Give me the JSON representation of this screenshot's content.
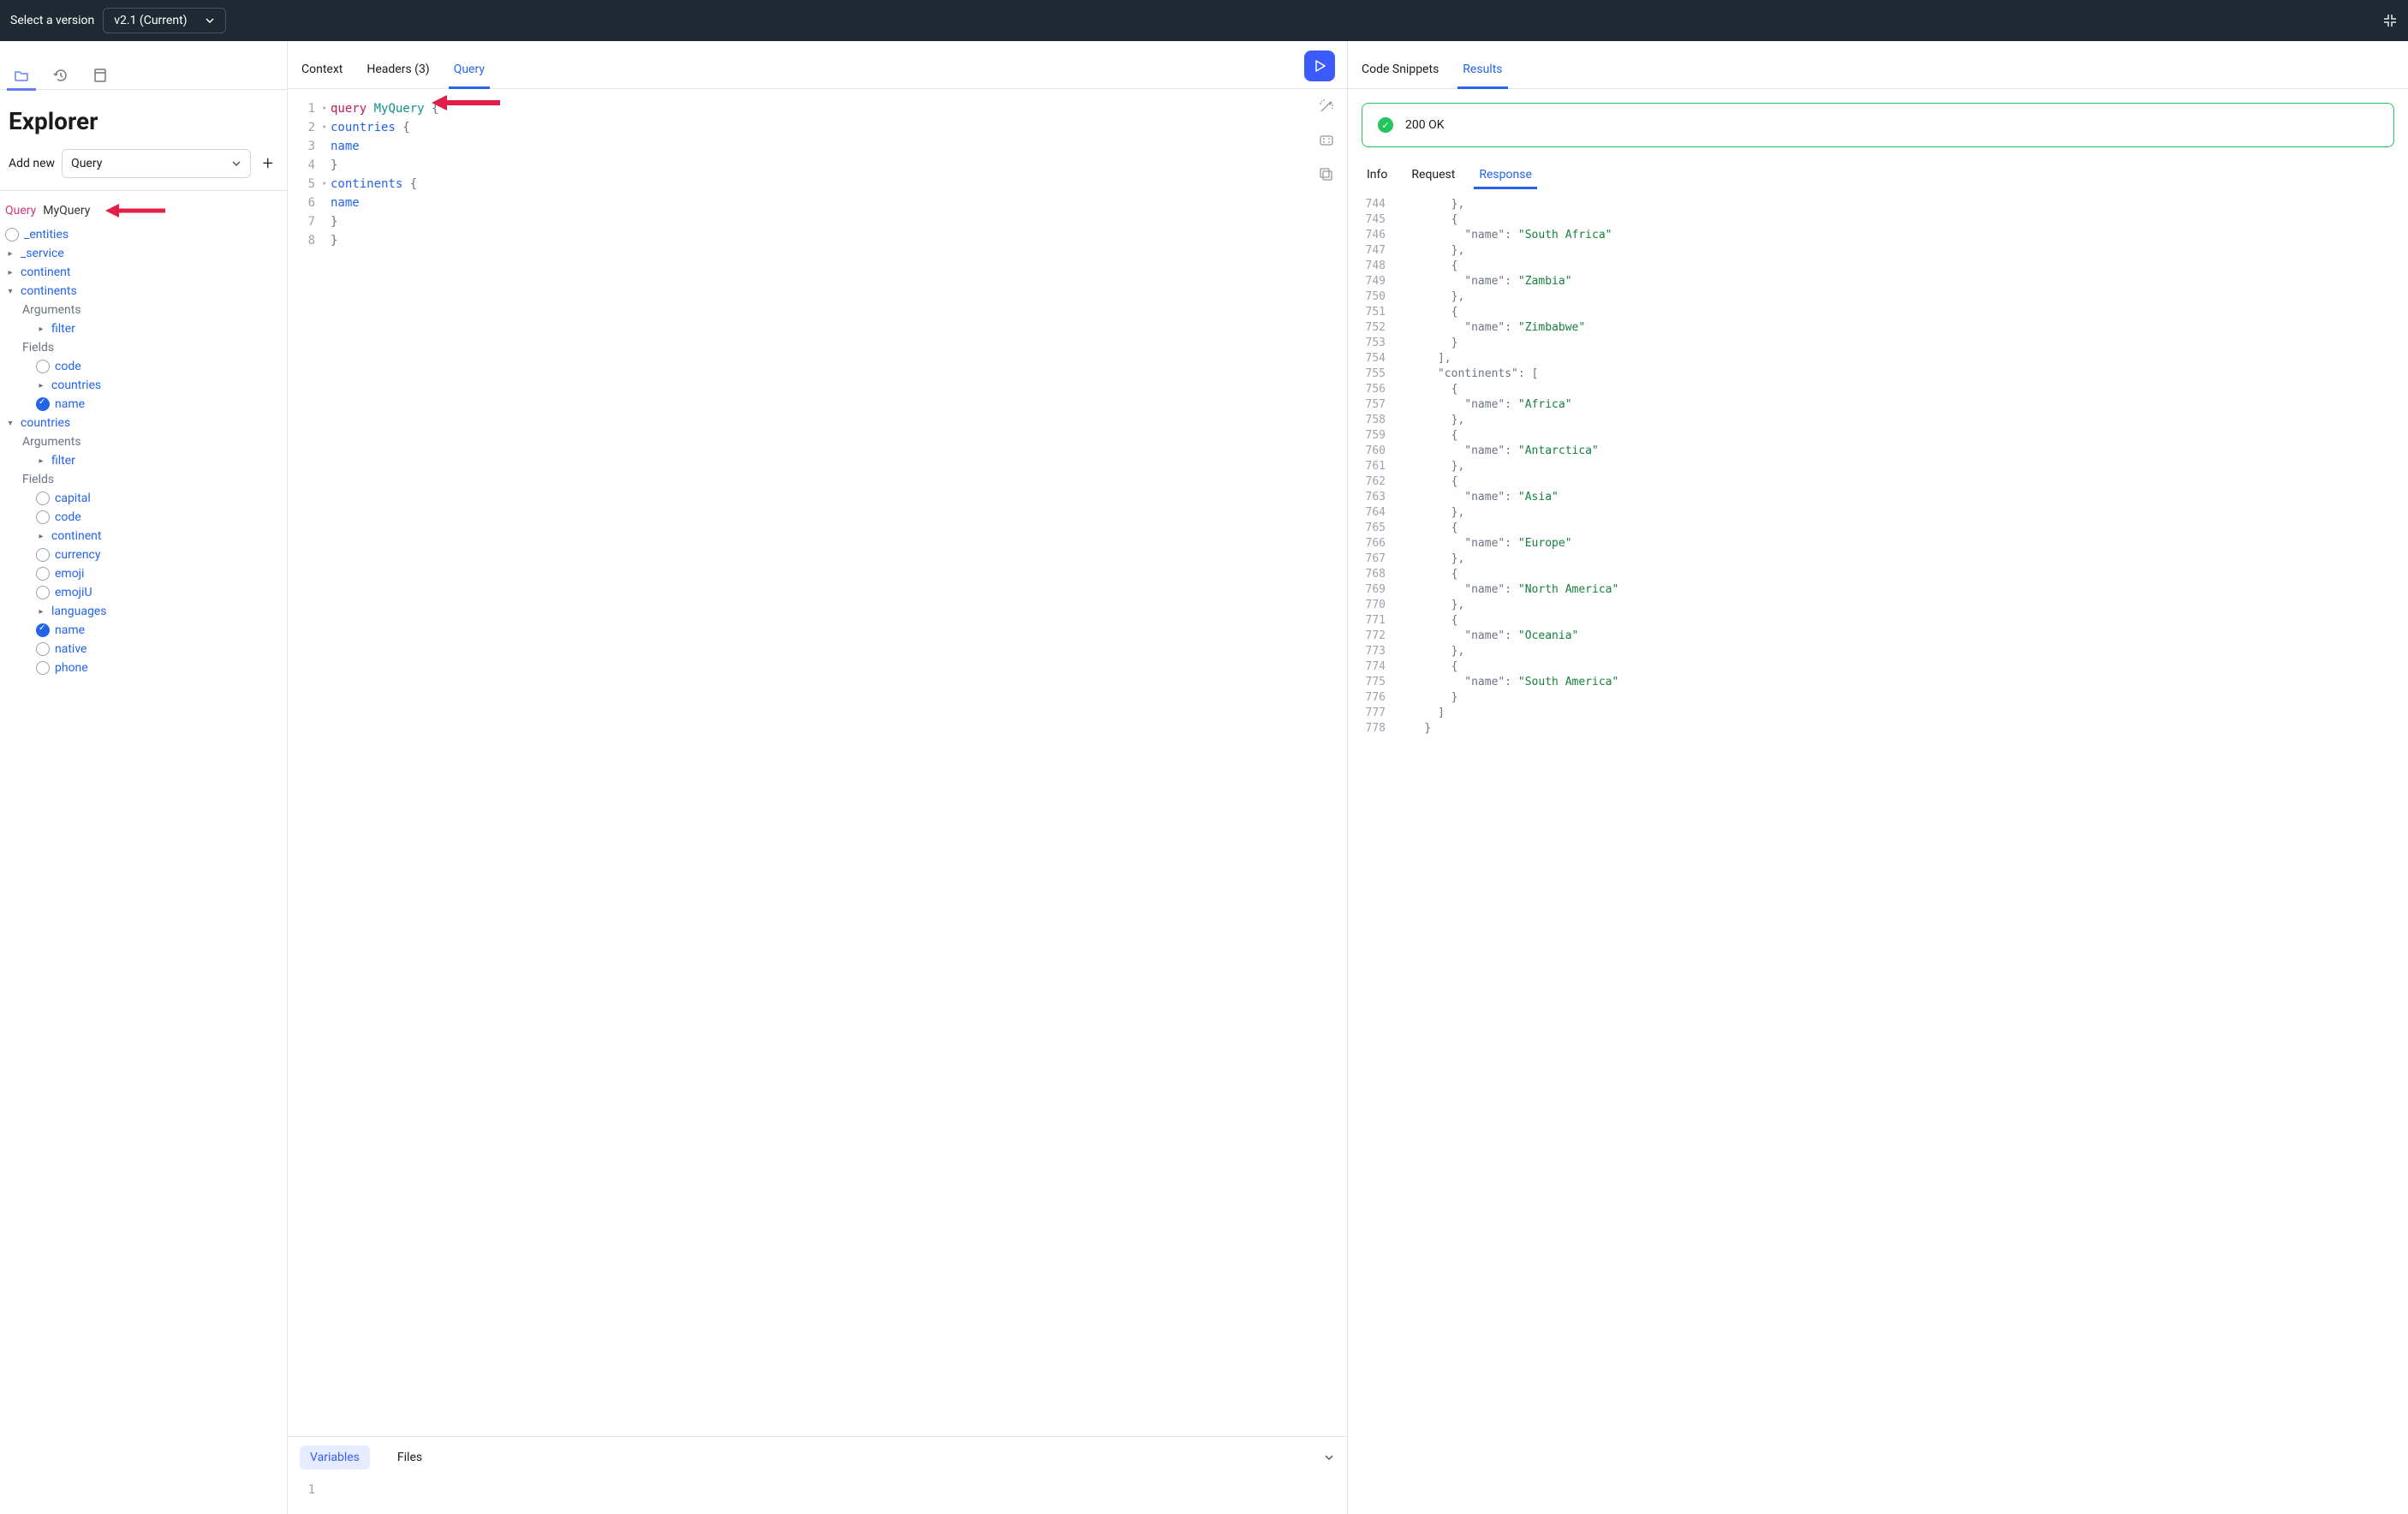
{
  "topbar": {
    "version_label": "Select a version",
    "version_value": "v2.1 (Current)"
  },
  "sidebar": {
    "title": "Explorer",
    "add_new_label": "Add new",
    "query_type": "Query",
    "query_keyword": "Query",
    "query_name": "MyQuery",
    "tree": {
      "entities": "_entities",
      "service": "_service",
      "continent": "continent",
      "continents": "continents",
      "countries": "countries",
      "arguments": "Arguments",
      "fields": "Fields",
      "filter": "filter",
      "code": "code",
      "countries_field": "countries",
      "name": "name",
      "capital": "capital",
      "continent_field": "continent",
      "currency": "currency",
      "emoji": "emoji",
      "emojiU": "emojiU",
      "languages": "languages",
      "native": "native",
      "phone": "phone"
    }
  },
  "middle": {
    "tabs": {
      "context": "Context",
      "headers": "Headers (3)",
      "query": "Query"
    },
    "bottom_tabs": {
      "variables": "Variables",
      "files": "Files"
    },
    "code": [
      {
        "n": "1",
        "fold": "▾",
        "html": "<span class='tok-keyword'>query</span> <span class='tok-name'>MyQuery</span> <span class='tok-brace'>{</span>"
      },
      {
        "n": "2",
        "fold": "▾",
        "html": "  <span class='tok-field'>countries</span> <span class='tok-brace'>{</span>"
      },
      {
        "n": "3",
        "fold": "",
        "html": "    <span class='tok-field'>name</span>"
      },
      {
        "n": "4",
        "fold": "",
        "html": "  <span class='tok-brace'>}</span>"
      },
      {
        "n": "5",
        "fold": "▾",
        "html": "  <span class='tok-field'>continents</span> <span class='tok-brace'>{</span>"
      },
      {
        "n": "6",
        "fold": "",
        "html": "    <span class='tok-field'>name</span>"
      },
      {
        "n": "7",
        "fold": "",
        "html": "  <span class='tok-brace'>}</span>"
      },
      {
        "n": "8",
        "fold": "",
        "html": "<span class='tok-brace'>}</span>"
      }
    ]
  },
  "right": {
    "tabs": {
      "snippets": "Code Snippets",
      "results": "Results"
    },
    "status": "200 OK",
    "sub_tabs": {
      "info": "Info",
      "request": "Request",
      "response": "Response"
    },
    "response": [
      {
        "n": "744",
        "html": "        <span class='j-punc'>},</span>"
      },
      {
        "n": "745",
        "html": "        <span class='j-punc'>{</span>"
      },
      {
        "n": "746",
        "html": "          <span class='j-key'>\"name\"</span><span class='j-punc'>: </span><span class='j-str'>\"South Africa\"</span>"
      },
      {
        "n": "747",
        "html": "        <span class='j-punc'>},</span>"
      },
      {
        "n": "748",
        "html": "        <span class='j-punc'>{</span>"
      },
      {
        "n": "749",
        "html": "          <span class='j-key'>\"name\"</span><span class='j-punc'>: </span><span class='j-str'>\"Zambia\"</span>"
      },
      {
        "n": "750",
        "html": "        <span class='j-punc'>},</span>"
      },
      {
        "n": "751",
        "html": "        <span class='j-punc'>{</span>"
      },
      {
        "n": "752",
        "html": "          <span class='j-key'>\"name\"</span><span class='j-punc'>: </span><span class='j-str'>\"Zimbabwe\"</span>"
      },
      {
        "n": "753",
        "html": "        <span class='j-punc'>}</span>"
      },
      {
        "n": "754",
        "html": "      <span class='j-punc'>],</span>"
      },
      {
        "n": "755",
        "html": "      <span class='j-key'>\"continents\"</span><span class='j-punc'>: [</span>"
      },
      {
        "n": "756",
        "html": "        <span class='j-punc'>{</span>"
      },
      {
        "n": "757",
        "html": "          <span class='j-key'>\"name\"</span><span class='j-punc'>: </span><span class='j-str'>\"Africa\"</span>"
      },
      {
        "n": "758",
        "html": "        <span class='j-punc'>},</span>"
      },
      {
        "n": "759",
        "html": "        <span class='j-punc'>{</span>"
      },
      {
        "n": "760",
        "html": "          <span class='j-key'>\"name\"</span><span class='j-punc'>: </span><span class='j-str'>\"Antarctica\"</span>"
      },
      {
        "n": "761",
        "html": "        <span class='j-punc'>},</span>"
      },
      {
        "n": "762",
        "html": "        <span class='j-punc'>{</span>"
      },
      {
        "n": "763",
        "html": "          <span class='j-key'>\"name\"</span><span class='j-punc'>: </span><span class='j-str'>\"Asia\"</span>"
      },
      {
        "n": "764",
        "html": "        <span class='j-punc'>},</span>"
      },
      {
        "n": "765",
        "html": "        <span class='j-punc'>{</span>"
      },
      {
        "n": "766",
        "html": "          <span class='j-key'>\"name\"</span><span class='j-punc'>: </span><span class='j-str'>\"Europe\"</span>"
      },
      {
        "n": "767",
        "html": "        <span class='j-punc'>},</span>"
      },
      {
        "n": "768",
        "html": "        <span class='j-punc'>{</span>"
      },
      {
        "n": "769",
        "html": "          <span class='j-key'>\"name\"</span><span class='j-punc'>: </span><span class='j-str'>\"North America\"</span>"
      },
      {
        "n": "770",
        "html": "        <span class='j-punc'>},</span>"
      },
      {
        "n": "771",
        "html": "        <span class='j-punc'>{</span>"
      },
      {
        "n": "772",
        "html": "          <span class='j-key'>\"name\"</span><span class='j-punc'>: </span><span class='j-str'>\"Oceania\"</span>"
      },
      {
        "n": "773",
        "html": "        <span class='j-punc'>},</span>"
      },
      {
        "n": "774",
        "html": "        <span class='j-punc'>{</span>"
      },
      {
        "n": "775",
        "html": "          <span class='j-key'>\"name\"</span><span class='j-punc'>: </span><span class='j-str'>\"South America\"</span>"
      },
      {
        "n": "776",
        "html": "        <span class='j-punc'>}</span>"
      },
      {
        "n": "777",
        "html": "      <span class='j-punc'>]</span>"
      },
      {
        "n": "778",
        "html": "    <span class='j-punc'>}</span>"
      }
    ]
  }
}
